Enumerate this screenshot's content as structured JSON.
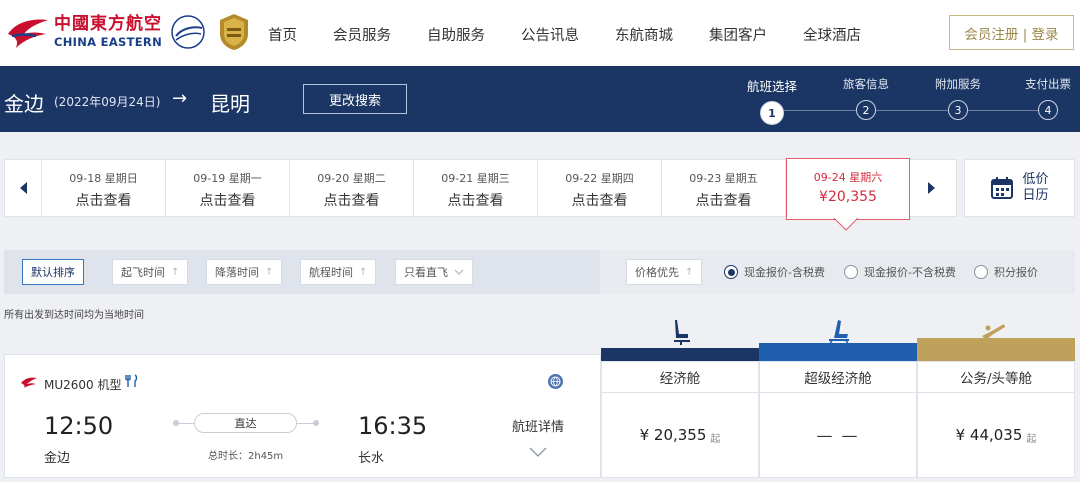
{
  "brand": {
    "name_cn": "中國東方航空",
    "name_en": "CHINA EASTERN"
  },
  "nav": {
    "items": [
      "首页",
      "会员服务",
      "自助服务",
      "公告讯息",
      "东航商城",
      "集团客户",
      "全球酒店"
    ],
    "auth_label": "会员注册 | 登录"
  },
  "search": {
    "from": "金边",
    "date": "(2022年09月24日)",
    "arrow": "→",
    "to": "昆明",
    "modify_label": "更改搜索"
  },
  "steps": [
    {
      "label": "航班选择",
      "num": "1"
    },
    {
      "label": "旅客信息",
      "num": "2"
    },
    {
      "label": "附加服务",
      "num": "3"
    },
    {
      "label": "支付出票",
      "num": "4"
    }
  ],
  "dates": [
    {
      "day": "09-18 星期日",
      "info": "点击查看"
    },
    {
      "day": "09-19 星期一",
      "info": "点击查看"
    },
    {
      "day": "09-20 星期二",
      "info": "点击查看"
    },
    {
      "day": "09-21 星期三",
      "info": "点击查看"
    },
    {
      "day": "09-22 星期四",
      "info": "点击查看"
    },
    {
      "day": "09-23 星期五",
      "info": "点击查看"
    },
    {
      "day": "09-24 星期六",
      "info": "¥20,355"
    }
  ],
  "low_calendar": {
    "line1": "低价",
    "line2": "日历"
  },
  "sort": {
    "default": "默认排序",
    "takeoff": "起飞时间",
    "landing": "降落时间",
    "duration": "航程时间",
    "direct_only": "只看直飞",
    "price_first": "价格优先",
    "up_arrow": "↑"
  },
  "price_modes": [
    {
      "label": "现金报价-含税费",
      "selected": true
    },
    {
      "label": "现金报价-不含税费",
      "selected": false
    },
    {
      "label": "积分报价",
      "selected": false
    }
  ],
  "time_note": "所有出发到达时间均为当地时间",
  "cabins": [
    {
      "label": "经济舱",
      "color": "#1b3564",
      "icon": "economy-seat-icon"
    },
    {
      "label": "超级经济舱",
      "color": "#1f5fad",
      "icon": "premium-economy-seat-icon"
    },
    {
      "label": "公务/头等舱",
      "color": "#bfa15c",
      "icon": "business-seat-icon"
    }
  ],
  "flight": {
    "number": "MU2600",
    "aircraft_label": "机型",
    "dep_time": "12:50",
    "dep_city": "金边",
    "arr_time": "16:35",
    "arr_city": "长水",
    "direct_label": "直达",
    "duration": "总时长：2h45m",
    "detail_label": "航班详情",
    "prices": {
      "economy": "¥ 20,355",
      "premium": "— —",
      "business": "¥ 44,035",
      "suffix": "起"
    }
  },
  "colors": {
    "brand_red": "#c8102e",
    "navy": "#1b3564",
    "gold": "#bfa15c",
    "highlight_red": "#d22e3f"
  }
}
